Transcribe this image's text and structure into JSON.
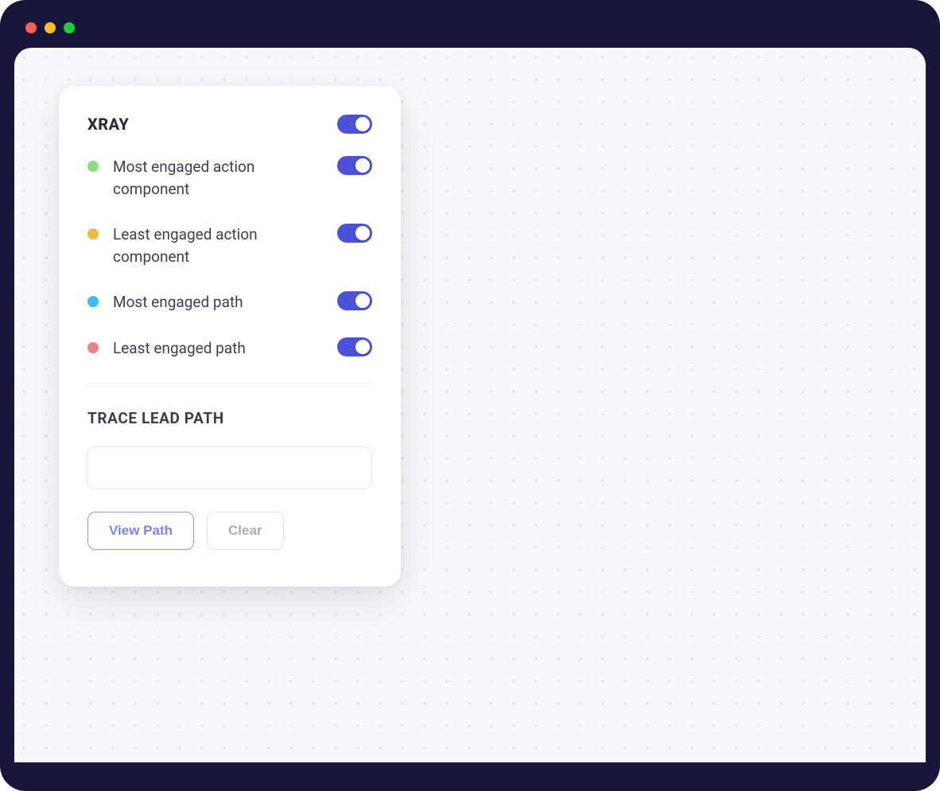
{
  "panel": {
    "title": "XRAY",
    "header_toggle": true,
    "options": [
      {
        "label": "Most engaged action component",
        "color": "#8DE07F",
        "on": true
      },
      {
        "label": "Least engaged action component",
        "color": "#F2B83C",
        "on": true
      },
      {
        "label": "Most engaged path",
        "color": "#3EBCF2",
        "on": true
      },
      {
        "label": "Least engaged path",
        "color": "#E88484",
        "on": true
      }
    ],
    "trace": {
      "title": "TRACE LEAD PATH",
      "input_value": "",
      "input_placeholder": "",
      "view_path_label": "View Path",
      "clear_label": "Clear"
    }
  },
  "colors": {
    "accent": "#4B52D8",
    "frame": "#18173B",
    "canvas_bg": "#F6F8FB"
  }
}
